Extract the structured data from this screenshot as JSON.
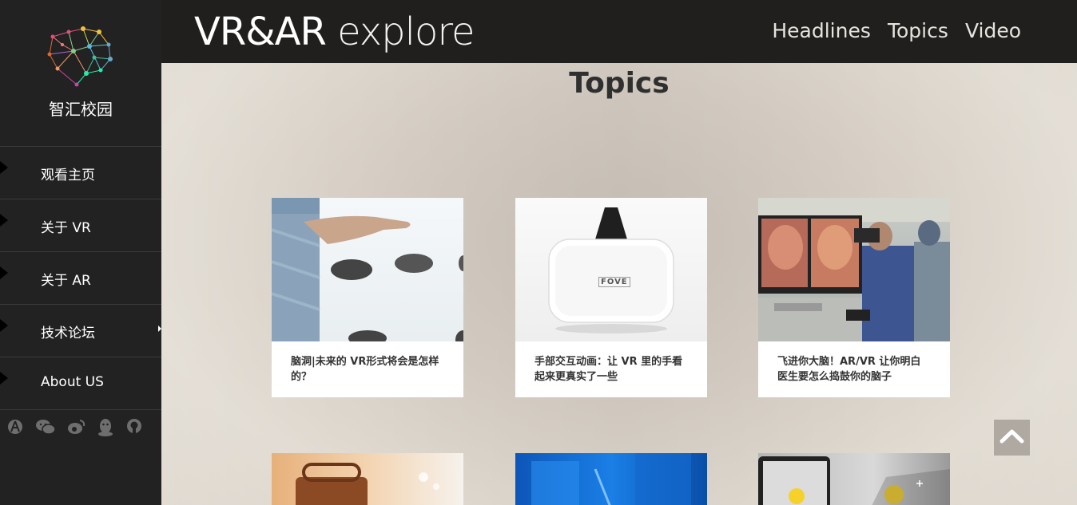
{
  "sidebar": {
    "logo_text": "智汇校园",
    "items": [
      {
        "label": "观看主页"
      },
      {
        "label": "关于  VR"
      },
      {
        "label": "关于  AR"
      },
      {
        "label": "技术论坛"
      },
      {
        "label": "About US"
      }
    ],
    "social_icons": [
      "apple-icon",
      "wechat-icon",
      "weibo-icon",
      "qq-icon",
      "github-icon"
    ]
  },
  "header": {
    "brand_main": "VR&AR",
    "brand_sub": " explore",
    "nav": [
      {
        "label": "Headlines"
      },
      {
        "label": "Topics"
      },
      {
        "label": "Video"
      }
    ]
  },
  "main": {
    "title": "Topics",
    "cards": [
      {
        "caption": "脑洞|未来的 VR形式将会是怎样的？"
      },
      {
        "caption": "手部交互动画：让 VR 里的手看起来更真实了一些",
        "thumb_text": "FOVE"
      },
      {
        "caption": "飞进你大脑！AR/VR 让你明白医生要怎么捣鼓你的脑子"
      }
    ]
  },
  "colors": {
    "sidebar_bg": "#222222",
    "header_bg": "#211f1d",
    "content_bg": "#d6cec4",
    "back_top_bg": "#b0a9a1"
  }
}
